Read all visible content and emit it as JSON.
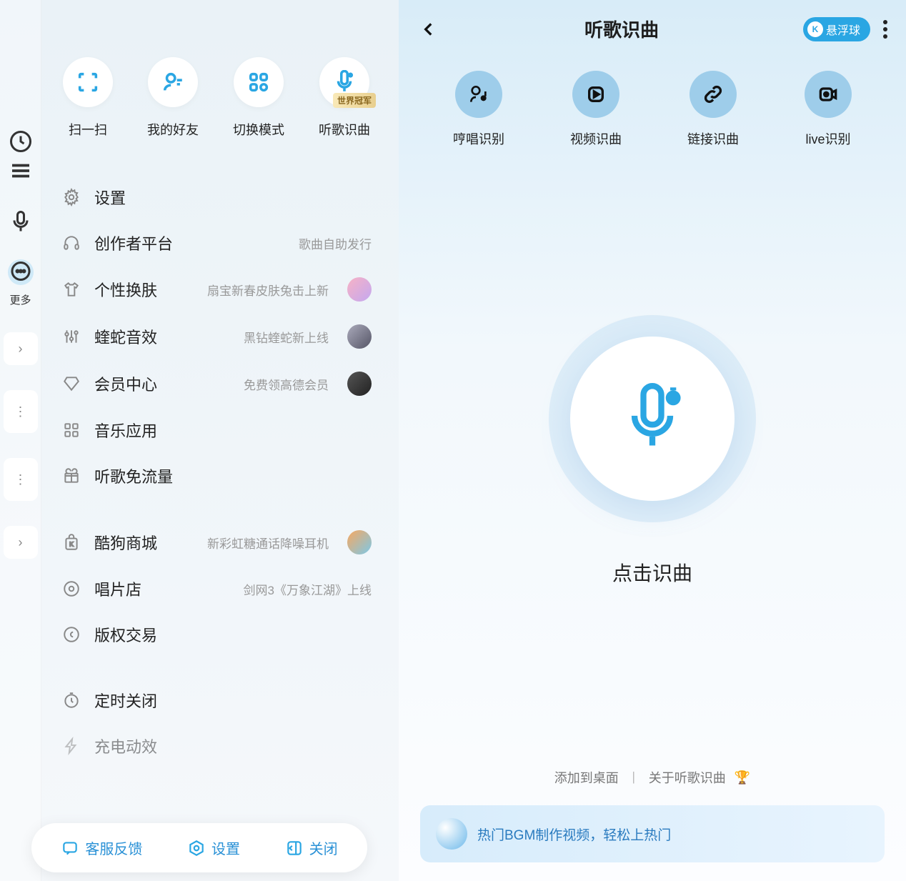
{
  "left": {
    "quick": [
      {
        "label": "扫一扫"
      },
      {
        "label": "我的好友"
      },
      {
        "label": "切换模式"
      },
      {
        "label": "听歌识曲",
        "badge": "世界冠军"
      }
    ],
    "edge_more": "更多",
    "menu": [
      {
        "label": "设置",
        "sub": ""
      },
      {
        "label": "创作者平台",
        "sub": "歌曲自助发行"
      },
      {
        "label": "个性换肤",
        "sub": "扇宝新春皮肤兔击上新",
        "thumb": "pink"
      },
      {
        "label": "蝰蛇音效",
        "sub": "黑钻蝰蛇新上线",
        "thumb": "gem"
      },
      {
        "label": "会员中心",
        "sub": "免费领高德会员",
        "thumb": "dark"
      },
      {
        "label": "音乐应用",
        "sub": ""
      },
      {
        "label": "听歌免流量",
        "sub": ""
      }
    ],
    "menu2": [
      {
        "label": "酷狗商城",
        "sub": "新彩虹糖通话降噪耳机",
        "thumb": "warm"
      },
      {
        "label": "唱片店",
        "sub": "剑网3《万象江湖》上线"
      },
      {
        "label": "版权交易",
        "sub": ""
      }
    ],
    "menu3": [
      {
        "label": "定时关闭",
        "sub": ""
      },
      {
        "label": "充电动效",
        "sub": ""
      }
    ],
    "bottom": {
      "feedback": "客服反馈",
      "settings": "设置",
      "close": "关闭"
    }
  },
  "right": {
    "title": "听歌识曲",
    "pill": "悬浮球",
    "modes": [
      {
        "label": "哼唱识别"
      },
      {
        "label": "视频识曲"
      },
      {
        "label": "链接识曲"
      },
      {
        "label": "live识别"
      }
    ],
    "cta": "点击识曲",
    "link_desktop": "添加到桌面",
    "link_about": "关于听歌识曲",
    "banner": "热门BGM制作视频，轻松上热门"
  }
}
